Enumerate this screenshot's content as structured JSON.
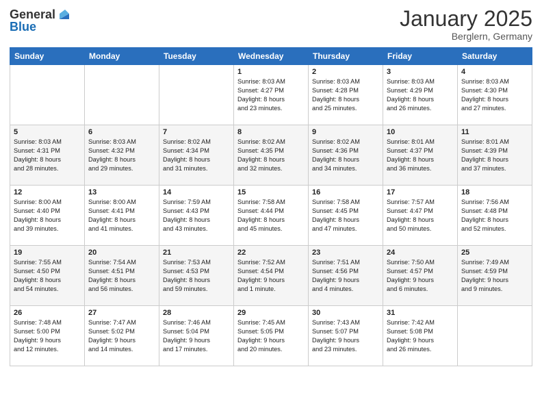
{
  "header": {
    "logo_general": "General",
    "logo_blue": "Blue",
    "month": "January 2025",
    "location": "Berglern, Germany"
  },
  "days_of_week": [
    "Sunday",
    "Monday",
    "Tuesday",
    "Wednesday",
    "Thursday",
    "Friday",
    "Saturday"
  ],
  "weeks": [
    [
      {
        "day": "",
        "info": ""
      },
      {
        "day": "",
        "info": ""
      },
      {
        "day": "",
        "info": ""
      },
      {
        "day": "1",
        "info": "Sunrise: 8:03 AM\nSunset: 4:27 PM\nDaylight: 8 hours\nand 23 minutes."
      },
      {
        "day": "2",
        "info": "Sunrise: 8:03 AM\nSunset: 4:28 PM\nDaylight: 8 hours\nand 25 minutes."
      },
      {
        "day": "3",
        "info": "Sunrise: 8:03 AM\nSunset: 4:29 PM\nDaylight: 8 hours\nand 26 minutes."
      },
      {
        "day": "4",
        "info": "Sunrise: 8:03 AM\nSunset: 4:30 PM\nDaylight: 8 hours\nand 27 minutes."
      }
    ],
    [
      {
        "day": "5",
        "info": "Sunrise: 8:03 AM\nSunset: 4:31 PM\nDaylight: 8 hours\nand 28 minutes."
      },
      {
        "day": "6",
        "info": "Sunrise: 8:03 AM\nSunset: 4:32 PM\nDaylight: 8 hours\nand 29 minutes."
      },
      {
        "day": "7",
        "info": "Sunrise: 8:02 AM\nSunset: 4:34 PM\nDaylight: 8 hours\nand 31 minutes."
      },
      {
        "day": "8",
        "info": "Sunrise: 8:02 AM\nSunset: 4:35 PM\nDaylight: 8 hours\nand 32 minutes."
      },
      {
        "day": "9",
        "info": "Sunrise: 8:02 AM\nSunset: 4:36 PM\nDaylight: 8 hours\nand 34 minutes."
      },
      {
        "day": "10",
        "info": "Sunrise: 8:01 AM\nSunset: 4:37 PM\nDaylight: 8 hours\nand 36 minutes."
      },
      {
        "day": "11",
        "info": "Sunrise: 8:01 AM\nSunset: 4:39 PM\nDaylight: 8 hours\nand 37 minutes."
      }
    ],
    [
      {
        "day": "12",
        "info": "Sunrise: 8:00 AM\nSunset: 4:40 PM\nDaylight: 8 hours\nand 39 minutes."
      },
      {
        "day": "13",
        "info": "Sunrise: 8:00 AM\nSunset: 4:41 PM\nDaylight: 8 hours\nand 41 minutes."
      },
      {
        "day": "14",
        "info": "Sunrise: 7:59 AM\nSunset: 4:43 PM\nDaylight: 8 hours\nand 43 minutes."
      },
      {
        "day": "15",
        "info": "Sunrise: 7:58 AM\nSunset: 4:44 PM\nDaylight: 8 hours\nand 45 minutes."
      },
      {
        "day": "16",
        "info": "Sunrise: 7:58 AM\nSunset: 4:45 PM\nDaylight: 8 hours\nand 47 minutes."
      },
      {
        "day": "17",
        "info": "Sunrise: 7:57 AM\nSunset: 4:47 PM\nDaylight: 8 hours\nand 50 minutes."
      },
      {
        "day": "18",
        "info": "Sunrise: 7:56 AM\nSunset: 4:48 PM\nDaylight: 8 hours\nand 52 minutes."
      }
    ],
    [
      {
        "day": "19",
        "info": "Sunrise: 7:55 AM\nSunset: 4:50 PM\nDaylight: 8 hours\nand 54 minutes."
      },
      {
        "day": "20",
        "info": "Sunrise: 7:54 AM\nSunset: 4:51 PM\nDaylight: 8 hours\nand 56 minutes."
      },
      {
        "day": "21",
        "info": "Sunrise: 7:53 AM\nSunset: 4:53 PM\nDaylight: 8 hours\nand 59 minutes."
      },
      {
        "day": "22",
        "info": "Sunrise: 7:52 AM\nSunset: 4:54 PM\nDaylight: 9 hours\nand 1 minute."
      },
      {
        "day": "23",
        "info": "Sunrise: 7:51 AM\nSunset: 4:56 PM\nDaylight: 9 hours\nand 4 minutes."
      },
      {
        "day": "24",
        "info": "Sunrise: 7:50 AM\nSunset: 4:57 PM\nDaylight: 9 hours\nand 6 minutes."
      },
      {
        "day": "25",
        "info": "Sunrise: 7:49 AM\nSunset: 4:59 PM\nDaylight: 9 hours\nand 9 minutes."
      }
    ],
    [
      {
        "day": "26",
        "info": "Sunrise: 7:48 AM\nSunset: 5:00 PM\nDaylight: 9 hours\nand 12 minutes."
      },
      {
        "day": "27",
        "info": "Sunrise: 7:47 AM\nSunset: 5:02 PM\nDaylight: 9 hours\nand 14 minutes."
      },
      {
        "day": "28",
        "info": "Sunrise: 7:46 AM\nSunset: 5:04 PM\nDaylight: 9 hours\nand 17 minutes."
      },
      {
        "day": "29",
        "info": "Sunrise: 7:45 AM\nSunset: 5:05 PM\nDaylight: 9 hours\nand 20 minutes."
      },
      {
        "day": "30",
        "info": "Sunrise: 7:43 AM\nSunset: 5:07 PM\nDaylight: 9 hours\nand 23 minutes."
      },
      {
        "day": "31",
        "info": "Sunrise: 7:42 AM\nSunset: 5:08 PM\nDaylight: 9 hours\nand 26 minutes."
      },
      {
        "day": "",
        "info": ""
      }
    ]
  ]
}
